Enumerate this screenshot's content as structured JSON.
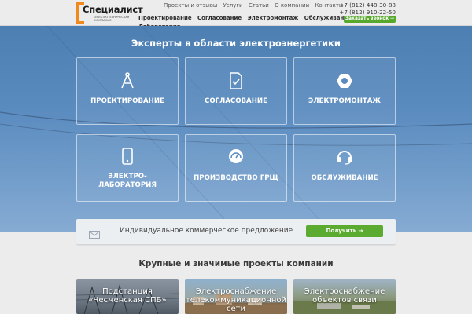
{
  "header": {
    "logo": {
      "title": "Специалист",
      "subtitle": "электротехническая компания"
    },
    "top_nav": [
      "Проекты и отзывы",
      "Услуги",
      "Статьи",
      "О компании",
      "Контакты"
    ],
    "main_nav": [
      "Проектирование",
      "Согласование",
      "Электромонтаж",
      "Обслуживание"
    ],
    "main_nav_wrap": "Лаборатория",
    "phones": [
      "+7 (812) 448-30-88",
      "+7 (812) 910-22-50"
    ],
    "call_button": "Заказать звонок →"
  },
  "hero": {
    "title": "Эксперты в области электроэнергетики",
    "tiles": [
      {
        "label": "ПРОЕКТИРОВАНИЕ",
        "icon": "compass-icon"
      },
      {
        "label": "СОГЛАСОВАНИЕ",
        "icon": "document-check-icon"
      },
      {
        "label": "ЭЛЕКТРОМОНТАЖ",
        "icon": "hex-nut-icon"
      },
      {
        "label": "ЭЛЕКТРО-\nЛАБОРАТОРИЯ",
        "icon": "tablet-icon"
      },
      {
        "label": "ПРОИЗВОДСТВО ГРЩ",
        "icon": "gauge-icon"
      },
      {
        "label": "ОБСЛУЖИВАНИЕ",
        "icon": "headset-icon"
      }
    ]
  },
  "offer": {
    "text": "Индивидуальное коммерческое предложение",
    "button": "Получить →",
    "icon": "envelope-icon"
  },
  "projects": {
    "title": "Крупные и значимые проекты компании",
    "cards": [
      {
        "label": "Подстанция «Чесменская СПБ»"
      },
      {
        "label": "Электроснабжение телекоммуникационной сети"
      },
      {
        "label": "Электроснабжение объектов связи"
      }
    ]
  },
  "colors": {
    "accent_green": "#5aab2f",
    "logo_orange": "#f08a1c",
    "hero_blue": "#5a8bbf"
  }
}
